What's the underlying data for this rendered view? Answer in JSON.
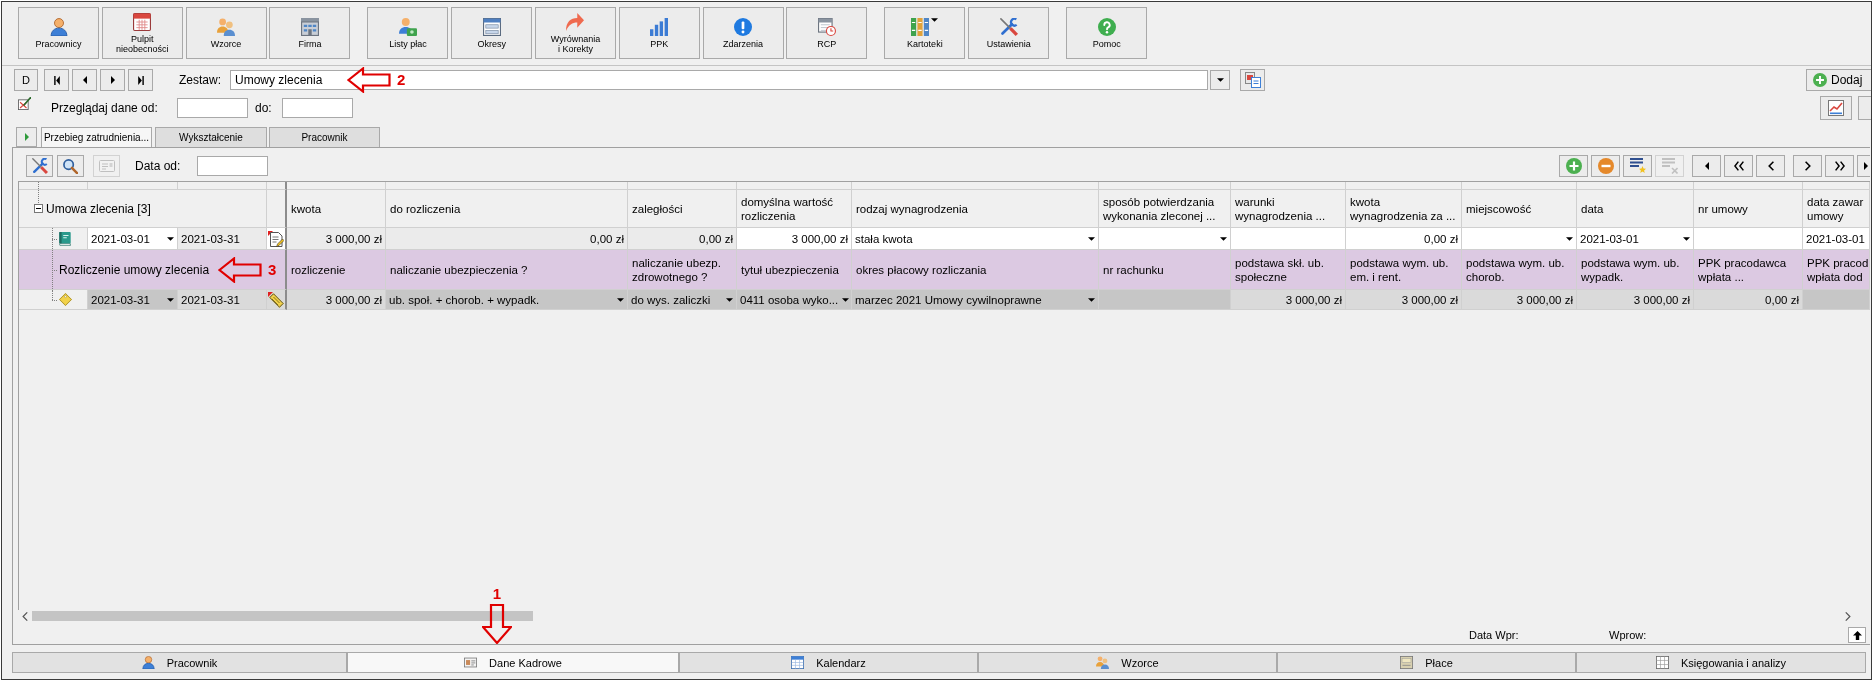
{
  "toolbar": {
    "groups": [
      [
        {
          "label": "Pracownicy",
          "menu": false
        },
        {
          "label": "Pulpit\nnieobecności",
          "menu": false
        },
        {
          "label": "Wzorce",
          "menu": false
        },
        {
          "label": "Firma",
          "menu": false
        }
      ],
      [
        {
          "label": "Listy płac",
          "menu": false
        },
        {
          "label": "Okresy",
          "menu": false
        },
        {
          "label": "Wyrównania\ni Korekty",
          "menu": false
        },
        {
          "label": "PPK",
          "menu": false
        },
        {
          "label": "Zdarzenia",
          "menu": false
        },
        {
          "label": "RCP",
          "menu": false
        }
      ],
      [
        {
          "label": "Kartoteki",
          "menu": true
        },
        {
          "label": "Ustawienia",
          "menu": false
        }
      ],
      [
        {
          "label": "Pomoc",
          "menu": false
        }
      ]
    ]
  },
  "navigator": {
    "buttons": [
      {
        "kind": "label",
        "label": "D"
      },
      {
        "kind": "first"
      },
      {
        "kind": "previous"
      },
      {
        "kind": "next"
      },
      {
        "kind": "last"
      }
    ],
    "set_label": "Zestaw:",
    "set_value": "Umowy zlecenia",
    "annotation": {
      "kind": "arrow_left",
      "label": "2"
    },
    "add_button": "Dodaj"
  },
  "date_filter": {
    "label": "Przeglądaj dane od:",
    "to_label": "do:"
  },
  "tabs": [
    {
      "label": "Przebieg zatrudnienia...",
      "selected": true
    },
    {
      "label": "Wykształcenie",
      "selected": false
    },
    {
      "label": "Pracownik",
      "selected": false
    }
  ],
  "panel_toolbar": {
    "left_buttons": [
      {
        "kind": "tools",
        "disabled": false
      },
      {
        "kind": "search",
        "disabled": false
      },
      {
        "kind": "card",
        "disabled": true
      }
    ],
    "date_label": "Data od:",
    "right_groups": [
      [
        {
          "kind": "add",
          "disabled": false
        },
        {
          "kind": "remove",
          "disabled": false
        },
        {
          "kind": "mark",
          "disabled": false
        },
        {
          "kind": "unmark",
          "disabled": true
        }
      ],
      [
        {
          "kind": "first",
          "disabled": false
        },
        {
          "kind": "page_back",
          "disabled": false
        },
        {
          "kind": "back",
          "disabled": false
        }
      ],
      [
        {
          "kind": "forward",
          "disabled": false
        },
        {
          "kind": "page_forward",
          "disabled": false
        },
        {
          "kind": "last",
          "disabled": false
        }
      ]
    ]
  },
  "grid": {
    "group": {
      "label": "Umowa zlecenia [3]",
      "expanded": true
    },
    "columns": [
      "kwota",
      "do rozliczenia",
      "zaległości",
      "domyślna wartość\nrozliczenia",
      "rodzaj wynagrodzenia",
      "sposób potwierdzania\nwykonania zleconej ...",
      "warunki\nwynagrodzenia ...",
      "kwota\nwynagrodzenia za ...",
      "miejscowość",
      "data",
      "nr umowy",
      "data zawar\numowy"
    ],
    "rows": [
      {
        "kind": "contract",
        "date_from": {
          "kind": "select",
          "value": "2021-03-01",
          "readonly": false
        },
        "date_to": {
          "kind": "text",
          "value": "2021-03-31",
          "readonly": true
        },
        "cells": [
          {
            "kind": "amount",
            "value": "3 000,00 zł",
            "readonly": true
          },
          {
            "kind": "amount",
            "value": "0,00 zł",
            "readonly": true
          },
          {
            "kind": "amount",
            "value": "0,00 zł",
            "readonly": true
          },
          {
            "kind": "amount",
            "value": "3 000,00 zł",
            "readonly": false
          },
          {
            "kind": "select",
            "value": "stała kwota",
            "readonly": false
          },
          {
            "kind": "select",
            "readonly": false
          },
          {
            "kind": "text",
            "readonly": false
          },
          {
            "kind": "amount",
            "value": "0,00 zł",
            "readonly": false
          },
          {
            "kind": "select",
            "readonly": false
          },
          {
            "kind": "select",
            "value": "2021-03-01",
            "readonly": false
          },
          {
            "kind": "text",
            "readonly": false
          },
          {
            "kind": "text",
            "value": "2021-03-01",
            "readonly": false
          }
        ]
      },
      {
        "kind": "heading",
        "label": "Rozliczenie umowy zlecenia",
        "annotation": {
          "kind": "arrow_left",
          "label": "3"
        },
        "cells": [
          "rozliczenie",
          "naliczanie ubezpieczenia ?",
          "naliczanie ubezp.\nzdrowotnego ?",
          "tytuł ubezpieczenia",
          "okres płacowy rozliczania",
          "nr rachunku",
          "podstawa skł. ub.\nspołeczne",
          "podstawa wym. ub.\nem. i rent.",
          "podstawa wym. ub.\nchorob.",
          "podstawa wym. ub.\nwypadk.",
          "PPK pracodawca\nwpłata ...",
          "PPK pracod\nwpłata dod"
        ]
      },
      {
        "kind": "settlement",
        "date_from": {
          "kind": "select",
          "value": "2021-03-31",
          "readonly": false
        },
        "date_to": {
          "kind": "text",
          "value": "2021-03-31",
          "readonly": true
        },
        "cells": [
          {
            "kind": "amount",
            "value": "3 000,00 zł",
            "readonly": true
          },
          {
            "kind": "select",
            "value": "ub. społ. + chorob. + wypadk.",
            "readonly": false
          },
          {
            "kind": "select",
            "value": "do wys. zaliczki",
            "readonly": false
          },
          {
            "kind": "select",
            "value": "0411 osoba wyko...",
            "readonly": false
          },
          {
            "kind": "select",
            "value": "marzec 2021 Umowy cywilnoprawne",
            "readonly": false
          },
          {
            "kind": "text",
            "readonly": false
          },
          {
            "kind": "amount",
            "value": "3 000,00 zł",
            "readonly": true
          },
          {
            "kind": "amount",
            "value": "3 000,00 zł",
            "readonly": true
          },
          {
            "kind": "amount",
            "value": "3 000,00 zł",
            "readonly": true
          },
          {
            "kind": "amount",
            "value": "3 000,00 zł",
            "readonly": true
          },
          {
            "kind": "amount",
            "value": "0,00 zł",
            "readonly": true
          },
          {
            "kind": "text",
            "readonly": false
          }
        ]
      }
    ]
  },
  "status_bar": {
    "date_label": "Data Wpr:",
    "entered_label": "Wprow:"
  },
  "bottom_tabs": [
    {
      "label": "Pracownik",
      "selected": false
    },
    {
      "label": "Dane Kadrowe",
      "selected": true,
      "annotation": {
        "kind": "arrow_down",
        "label": "1"
      }
    },
    {
      "label": "Kalendarz",
      "selected": false
    },
    {
      "label": "Wzorce",
      "selected": false
    },
    {
      "label": "Płace",
      "selected": false
    },
    {
      "label": "Księgowania i analizy",
      "selected": false
    }
  ]
}
